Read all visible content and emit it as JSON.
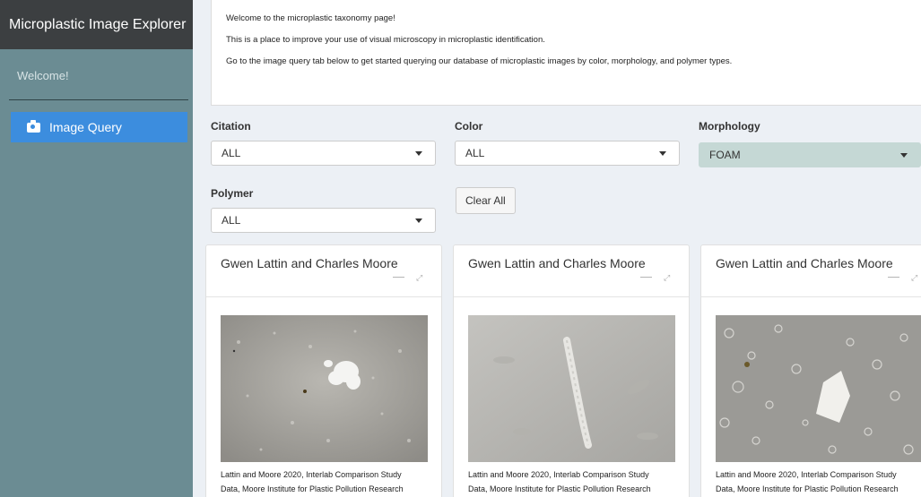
{
  "app": {
    "title": "Microplastic Image Explorer"
  },
  "sidebar": {
    "welcome": "Welcome!",
    "items": [
      {
        "label": "Image Query",
        "icon": "camera-icon",
        "active": true
      }
    ]
  },
  "intro": {
    "lines": [
      "Welcome to the microplastic taxonomy page!",
      "This is a place to improve your use of visual microscopy in microplastic identification.",
      "Go to the image query tab below to get started querying our database of microplastic images by color, morphology, and polymer types."
    ]
  },
  "filters": {
    "citation": {
      "label": "Citation",
      "value": "ALL"
    },
    "color": {
      "label": "Color",
      "value": "ALL"
    },
    "morphology": {
      "label": "Morphology",
      "value": "FOAM"
    },
    "polymer": {
      "label": "Polymer",
      "value": "ALL"
    },
    "clear_label": "Clear All"
  },
  "cards": [
    {
      "title": "Gwen Lattin and Charles Moore",
      "caption_line1": "Lattin and Moore 2020, Interlab Comparison Study",
      "caption_line2": "Data, Moore Institute for Plastic Pollution Research"
    },
    {
      "title": "Gwen Lattin and Charles Moore",
      "caption_line1": "Lattin and Moore 2020, Interlab Comparison Study",
      "caption_line2": "Data, Moore Institute for Plastic Pollution Research"
    },
    {
      "title": "Gwen Lattin and Charles Moore",
      "caption_line1": "Lattin and Moore 2020, Interlab Comparison Study",
      "caption_line2": "Data, Moore Institute for Plastic Pollution Research"
    }
  ],
  "colors": {
    "brand_bg": "#3c3f41",
    "sidebar_bg": "#6b8c93",
    "active_nav": "#3c8dde",
    "active_select": "#c5d8d5"
  }
}
